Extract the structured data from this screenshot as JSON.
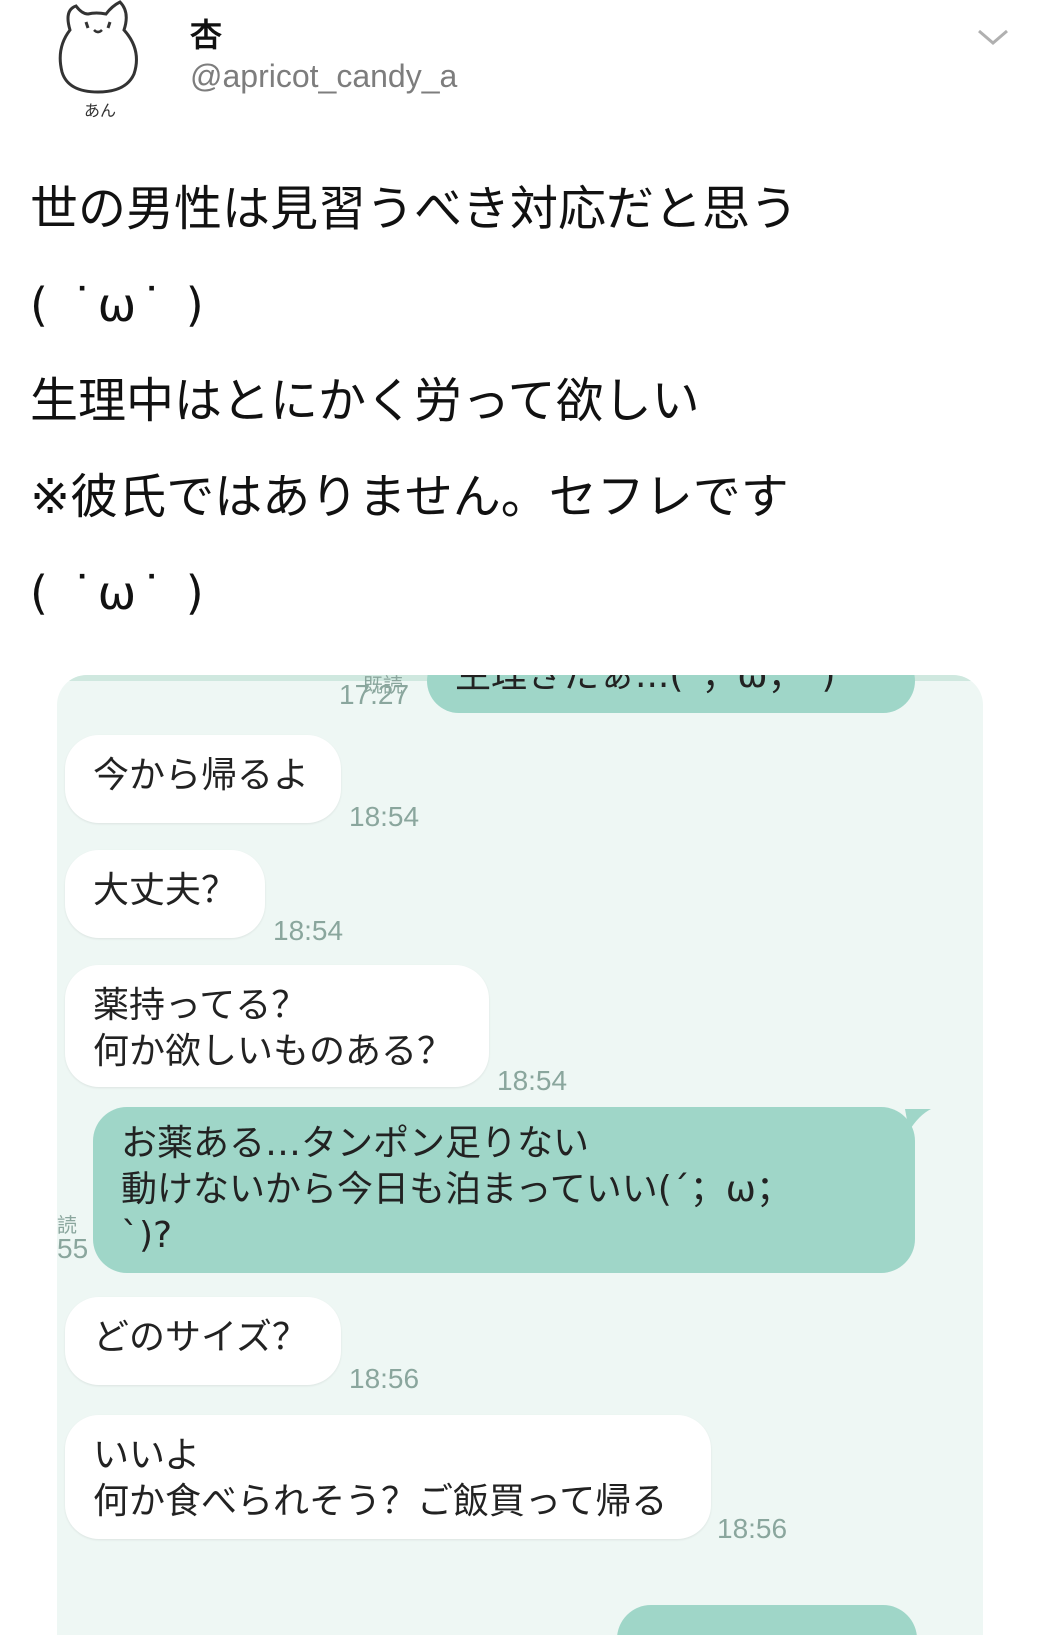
{
  "profile": {
    "display_name": "杏",
    "handle": "@apricot_candy_a",
    "avatar_caption": "あん"
  },
  "tweet": {
    "lines": [
      "世の男性は見習うべき対応だと思う",
      "( ˙ω˙ )",
      "生理中はとにかく労って欲しい",
      "※彼氏ではありません。セフレです",
      "( ˙ω˙ )"
    ]
  },
  "chat": {
    "messages": [
      {
        "side": "out",
        "lines": [
          "生理きたぁ...(´；ω；`)"
        ],
        "time": "17:27",
        "read": "既読"
      },
      {
        "side": "in",
        "lines": [
          "今から帰るよ"
        ],
        "time": "18:54"
      },
      {
        "side": "in",
        "lines": [
          "大丈夫？"
        ],
        "time": "18:54"
      },
      {
        "side": "in",
        "lines": [
          "薬持ってる？",
          "何か欲しいものある？"
        ],
        "time": "18:54"
      },
      {
        "side": "out",
        "lines": [
          "お薬ある…タンポン足りない",
          "動けないから今日も泊まっていい(´；ω；",
          "`)?"
        ],
        "time": "55",
        "read": "読"
      },
      {
        "side": "in",
        "lines": [
          "どのサイズ？"
        ],
        "time": "18:56"
      },
      {
        "side": "in",
        "lines": [
          "いいよ",
          "何か食べられそう？ご飯買って帰る"
        ],
        "time": "18:56"
      }
    ]
  },
  "colors": {
    "chat_background": "#eef7f4",
    "outgoing_bubble": "#9fd6c8",
    "incoming_bubble": "#ffffff",
    "timestamp": "#8aa69d",
    "handle": "#7d7d7d"
  },
  "icons": {
    "menu": "chevron-down-icon",
    "avatar": "cat-doodle-avatar"
  }
}
